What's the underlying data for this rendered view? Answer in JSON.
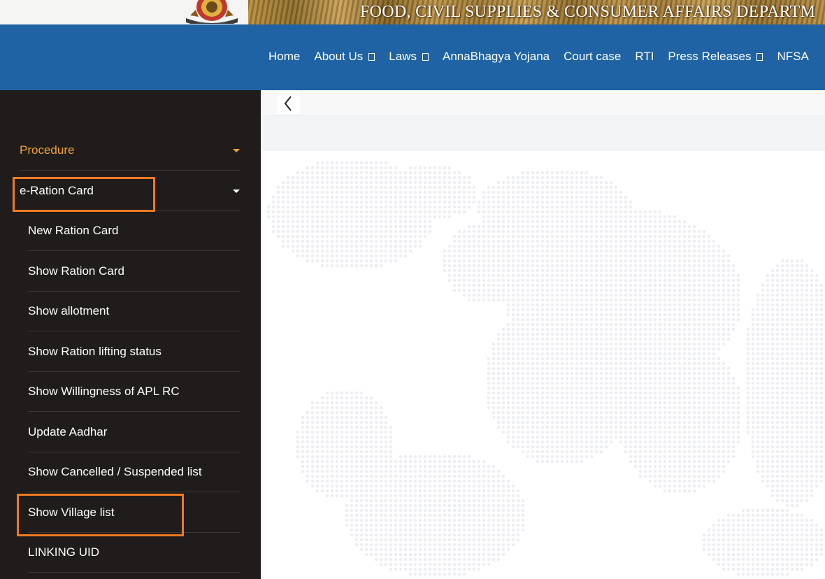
{
  "header": {
    "department_title": "FOOD, CIVIL SUPPLIES & CONSUMER AFFAIRS DEPARTM"
  },
  "nav": {
    "items": [
      {
        "label": "Home",
        "has_dropdown": false
      },
      {
        "label": "About Us",
        "has_dropdown": true
      },
      {
        "label": "Laws",
        "has_dropdown": true
      },
      {
        "label": "AnnaBhagya Yojana",
        "has_dropdown": false
      },
      {
        "label": "Court case",
        "has_dropdown": false
      },
      {
        "label": "RTI",
        "has_dropdown": false
      },
      {
        "label": "Press Releases",
        "has_dropdown": true
      },
      {
        "label": "NFSA",
        "has_dropdown": false
      }
    ]
  },
  "sidebar": {
    "procedure_label": "Procedure",
    "eration_label": "e-Ration Card",
    "sub_items": [
      "New Ration Card",
      "Show Ration Card",
      "Show allotment",
      "Show Ration lifting status",
      "Show Willingness of APL RC",
      "Update Aadhar",
      "Show Cancelled / Suspended list",
      "Show Village list",
      "LINKING UID"
    ]
  },
  "toolbar": {
    "back_icon": "chevron-left-icon"
  },
  "colors": {
    "nav_bg": "#1f63a4",
    "sidebar_bg": "#1f1c1b",
    "accent_orange": "#f2a132",
    "highlight_orange": "#ef7a22",
    "map_dot": "#eceef2"
  }
}
